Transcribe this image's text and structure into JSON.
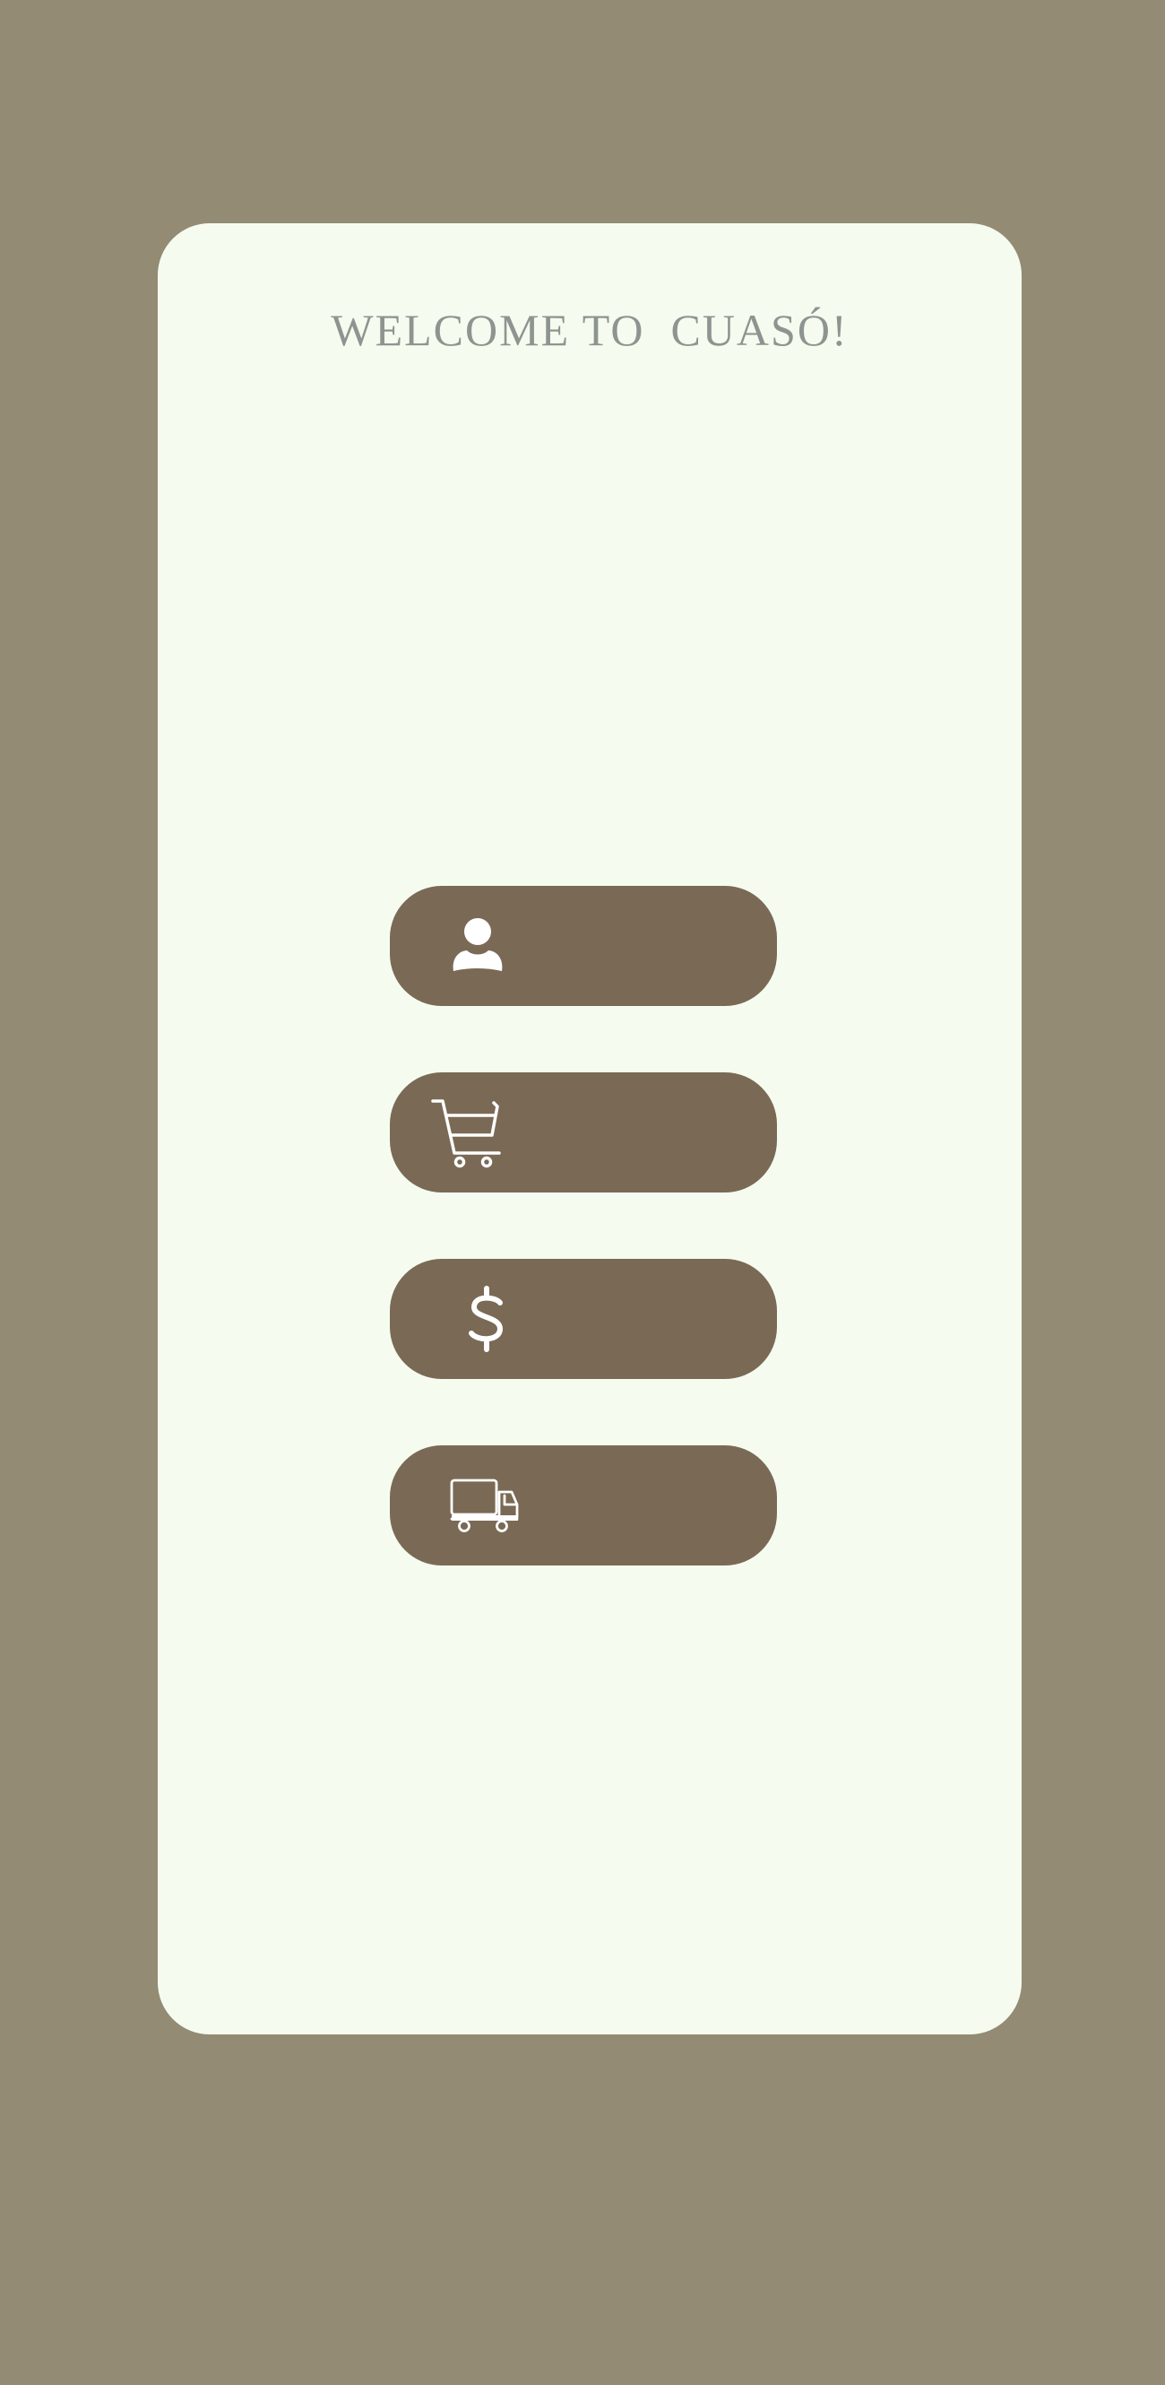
{
  "app": {
    "title": "WELCOME TO  CUASÓ!"
  },
  "menu": {
    "buttons": [
      {
        "name": "profile-button",
        "icon": "user-icon"
      },
      {
        "name": "cart-button",
        "icon": "shopping-cart-icon"
      },
      {
        "name": "payments-button",
        "icon": "dollar-icon"
      },
      {
        "name": "delivery-button",
        "icon": "delivery-truck-icon"
      }
    ]
  },
  "colors": {
    "background": "#938b74",
    "card": "#f5fcef",
    "button": "#7a6a55",
    "title": "#8e9590",
    "icon": "#ffffff"
  }
}
